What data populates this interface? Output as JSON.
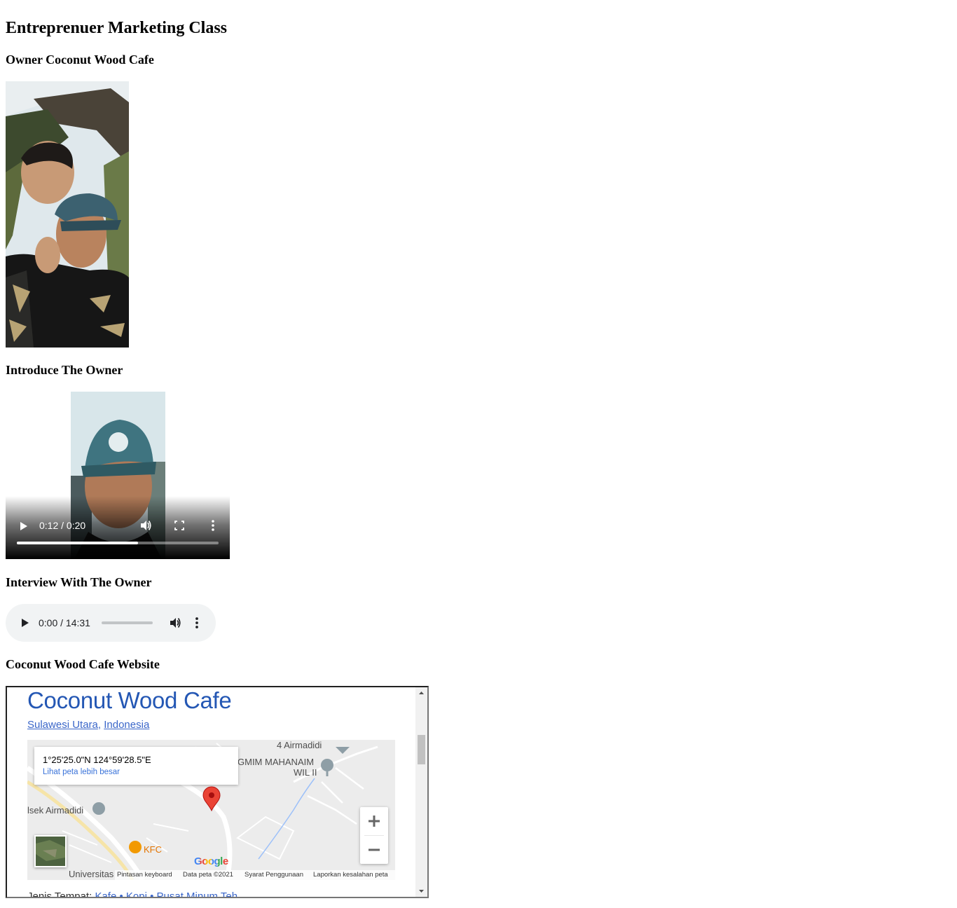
{
  "page": {
    "title": "Entreprenuer Marketing Class",
    "owner_heading": "Owner Coconut Wood Cafe",
    "video_heading": "Introduce The Owner",
    "audio_heading": "Interview With The Owner",
    "website_heading": "Coconut Wood Cafe Website"
  },
  "video": {
    "time": "0:12 / 0:20",
    "progress_fraction": 0.6
  },
  "audio": {
    "time": "0:00 / 14:31",
    "progress_fraction": 0.0
  },
  "website": {
    "title": "Coconut Wood Cafe",
    "location_parts": [
      "Sulawesi Utara",
      "Indonesia"
    ],
    "location_separator": ", ",
    "below_label": "Jenis Tempat:",
    "below_link": "Kafe • Kopi • Pusat Minum Teh",
    "map": {
      "coords": "1°25'25.0\"N 124°59'28.5\"E",
      "larger_map_link": "Lihat peta lebih besar",
      "labels": [
        "4 Airmadidi",
        "GMIM MAHANAIM",
        "WIL II",
        "lsek Airmadidi",
        "KFC",
        "Universitas"
      ],
      "google_logo": "Google",
      "footer": [
        "Pintasan keyboard",
        "Data peta ©2021",
        "Syarat Penggunaan",
        "Laporkan kesalahan peta"
      ]
    }
  },
  "colors": {
    "link": "#3a66c9",
    "site_title": "#2457b4",
    "pin": "#ea4335",
    "audio_bg": "#f1f3f4"
  },
  "icons": [
    "play-icon",
    "volume-icon",
    "fullscreen-icon",
    "more-vert-icon",
    "zoom-in-icon",
    "zoom-out-icon",
    "map-pin-icon"
  ]
}
